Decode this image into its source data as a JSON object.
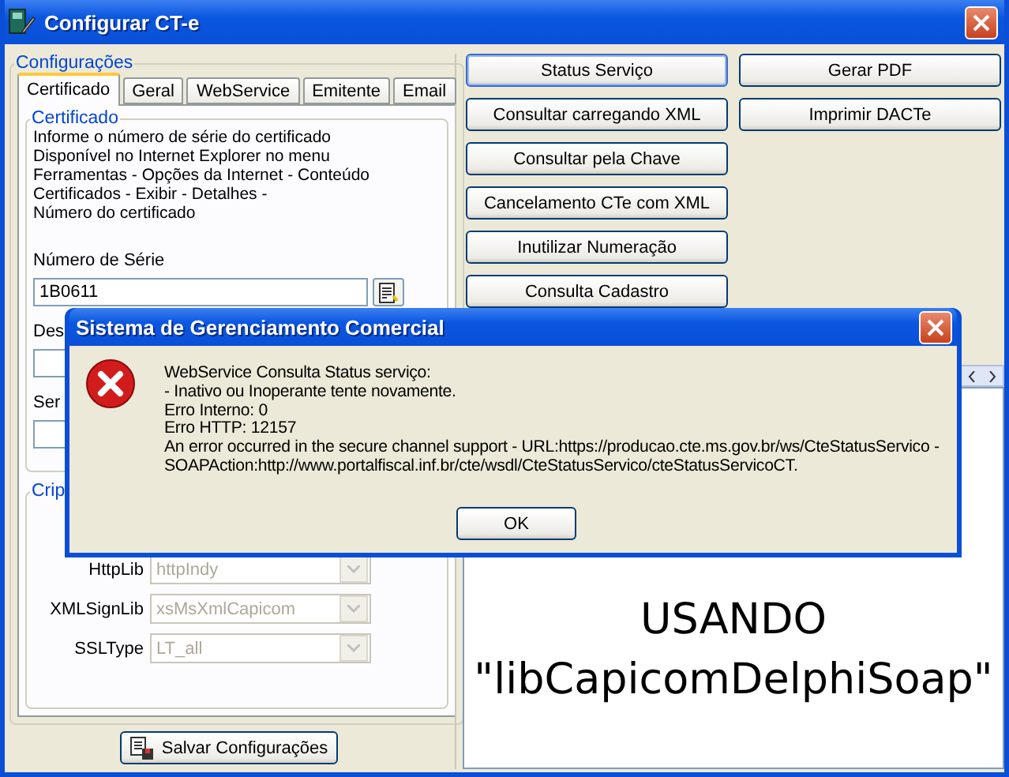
{
  "window": {
    "title": "Configurar CT-e"
  },
  "config": {
    "title": "Configurações",
    "tabs": [
      {
        "label": "Certificado",
        "selected": true
      },
      {
        "label": "Geral",
        "selected": false
      },
      {
        "label": "WebService",
        "selected": false
      },
      {
        "label": "Emitente",
        "selected": false
      },
      {
        "label": "Email",
        "selected": false
      }
    ],
    "certificate": {
      "title": "Certificado",
      "info_lines": [
        "Informe o número de série do certificado",
        "Disponível no Internet Explorer no menu",
        "Ferramentas - Opções da Internet - Conteúdo",
        "Certificados - Exibir - Detalhes -",
        "Número do certificado"
      ],
      "serial_label": "Número de Série",
      "serial_value": "1B0611",
      "label_2": "Des",
      "label_3": "Ser"
    },
    "crypto": {
      "title": "Crip",
      "fields": [
        {
          "label": "HttpLib",
          "value": "httpIndy",
          "disabled": true
        },
        {
          "label": "XMLSignLib",
          "value": "xsMsXmlCapicom",
          "disabled": true
        },
        {
          "label": "SSLType",
          "value": "LT_all",
          "disabled": true
        }
      ]
    }
  },
  "save_button": "Salvar Configurações",
  "actions_left": [
    {
      "label": "Status Serviço",
      "focused": true
    },
    {
      "label": "Consultar carregando XML",
      "focused": false
    },
    {
      "label": "Consultar pela Chave",
      "focused": false
    },
    {
      "label": "Cancelamento CTe com XML",
      "focused": false
    },
    {
      "label": "Inutilizar Numeração",
      "focused": false
    },
    {
      "label": "Consulta Cadastro",
      "focused": false
    }
  ],
  "actions_right": [
    {
      "label": "Gerar PDF",
      "focused": false
    },
    {
      "label": "Imprimir DACTe",
      "focused": false
    }
  ],
  "memo_lines": [
    "USANDO",
    "\"libCapicomDelphiSoap\""
  ],
  "dialog": {
    "title": "Sistema de Gerenciamento Comercial",
    "lines": [
      "WebService Consulta Status serviço:",
      "- Inativo ou Inoperante tente novamente.",
      "Erro Interno: 0",
      "Erro HTTP: 12157",
      "An error occurred in the secure channel support - URL:https://producao.cte.ms.gov.br/ws/CteStatusServico -",
      "SOAPAction:http://www.portalfiscal.inf.br/cte/wsdl/CteStatusServico/cteStatusServicoCT."
    ],
    "button": "OK"
  }
}
